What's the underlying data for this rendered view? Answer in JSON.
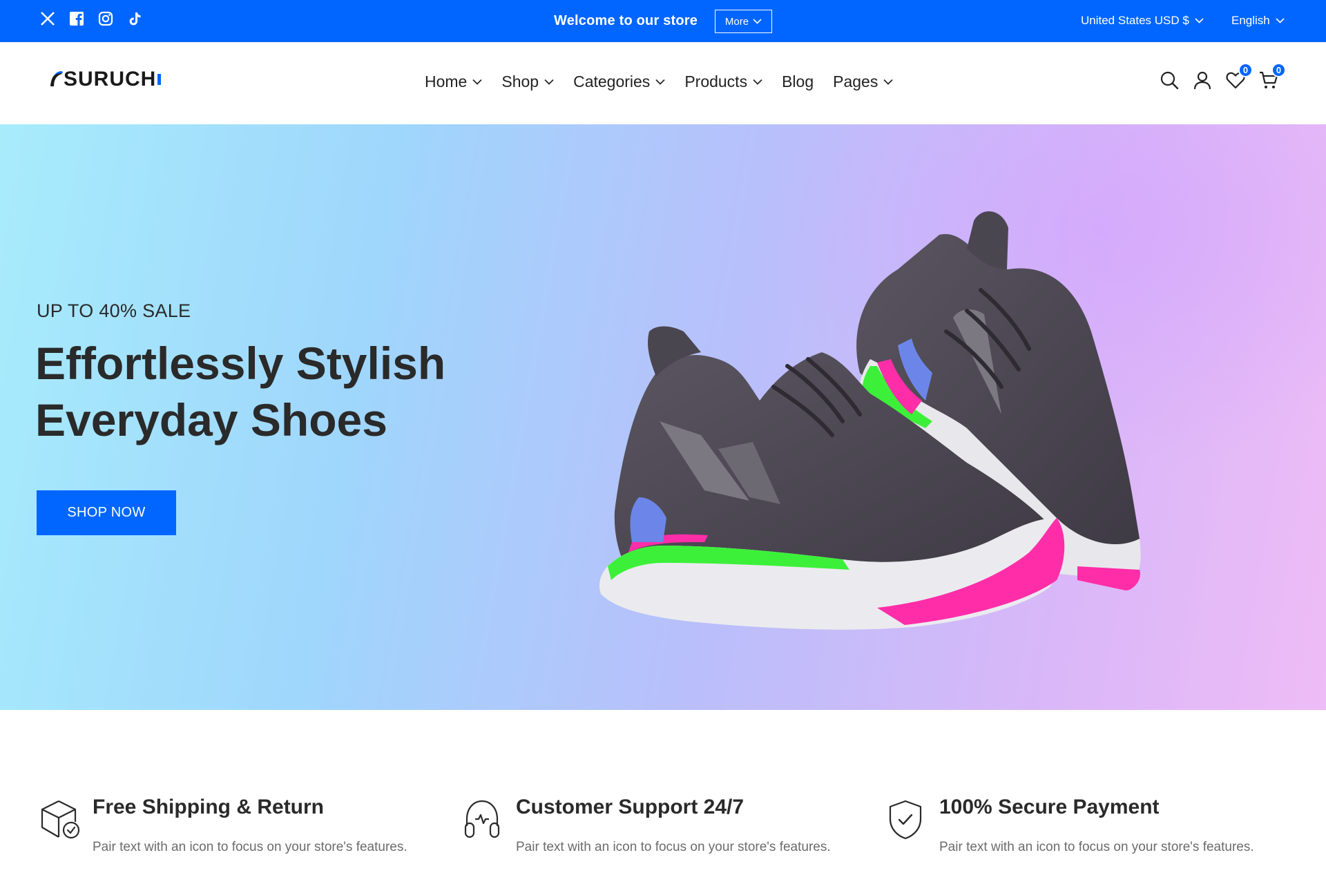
{
  "topbar": {
    "social": [
      "x-icon",
      "facebook-icon",
      "instagram-icon",
      "tiktok-icon"
    ],
    "welcome": "Welcome to our store",
    "more_label": "More",
    "currency": "United States USD $",
    "language": "English",
    "bg_color": "#0066ff"
  },
  "header": {
    "logo_text": "SURUCH",
    "nav": [
      {
        "label": "Home"
      },
      {
        "label": "Shop"
      },
      {
        "label": "Categories"
      },
      {
        "label": "Products"
      },
      {
        "label": "Blog"
      },
      {
        "label": "Pages"
      }
    ],
    "icons": [
      "search-icon",
      "account-icon",
      "wishlist-icon",
      "cart-icon"
    ],
    "wishlist_count": "0",
    "cart_count": "0"
  },
  "hero": {
    "subtitle": "UP TO 40% SALE",
    "title_line1": "Effortlessly Stylish",
    "title_line2": "Everyday Shoes",
    "button_label": "SHOP NOW"
  },
  "features": [
    {
      "icon": "box-check-icon",
      "title": "Free Shipping & Return",
      "desc": "Pair text with an icon to focus on your store's features."
    },
    {
      "icon": "headset-icon",
      "title": "Customer Support 24/7",
      "desc": "Pair text with an icon to focus on your store's features."
    },
    {
      "icon": "shield-check-icon",
      "title": "100% Secure Payment",
      "desc": "Pair text with an icon to focus on your store's features."
    }
  ],
  "colors": {
    "accent": "#0066ff",
    "heading": "#2a2a2a",
    "body_text": "#6b6b6b"
  }
}
